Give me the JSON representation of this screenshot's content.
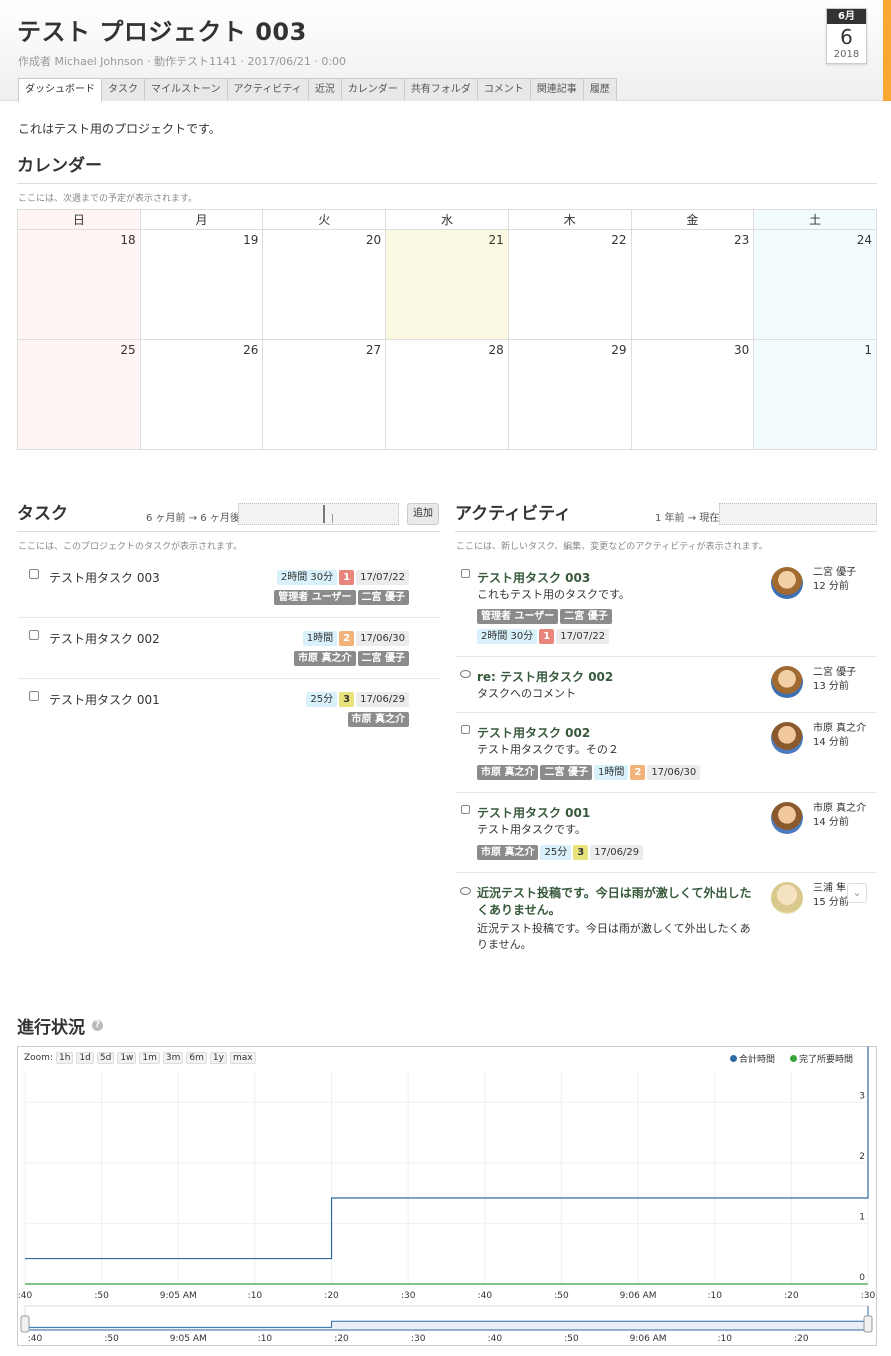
{
  "project": {
    "title": "テスト プロジェクト 003",
    "meta": "作成者 Michael Johnson · 動作テスト1141 · 2017/06/21 · 0:00",
    "description": "これはテスト用のプロジェクトです。"
  },
  "date_badge": {
    "month": "6月",
    "day": "6",
    "year": "2018"
  },
  "tabs": [
    "ダッシュボード",
    "タスク",
    "マイルストーン",
    "アクティビティ",
    "近況",
    "カレンダー",
    "共有フォルダ",
    "コメント",
    "関連記事",
    "履歴"
  ],
  "calendar": {
    "heading": "カレンダー",
    "note": "ここには、次週までの予定が表示されます。",
    "weekdays": [
      "日",
      "月",
      "火",
      "水",
      "木",
      "金",
      "土"
    ],
    "week1": [
      "18",
      "19",
      "20",
      "21",
      "22",
      "23",
      "24"
    ],
    "week2": [
      "25",
      "26",
      "27",
      "28",
      "29",
      "30",
      "1"
    ]
  },
  "tasks": {
    "heading": "タスク",
    "range_label": "6 ヶ月前 → 6 ヶ月後",
    "add_label": "追加",
    "note": "ここには、このプロジェクトのタスクが表示されます。",
    "items": [
      {
        "name": "テスト用タスク 003",
        "time": "2時間 30分",
        "priority": "1",
        "due": "17/07/22",
        "users": [
          "管理者 ユーザー",
          "二宮 優子"
        ]
      },
      {
        "name": "テスト用タスク 002",
        "time": "1時間",
        "priority": "2",
        "due": "17/06/30",
        "users": [
          "市原 真之介",
          "二宮 優子"
        ]
      },
      {
        "name": "テスト用タスク 001",
        "time": "25分",
        "priority": "3",
        "due": "17/06/29",
        "users": [
          "市原 真之介"
        ]
      }
    ]
  },
  "activity": {
    "heading": "アクティビティ",
    "range_label": "1 年前 → 現在",
    "note": "ここには、新しいタスク、編集、変更などのアクティビティが表示されます。",
    "items": [
      {
        "title": "テスト用タスク 003",
        "body": "これもテスト用のタスクです。",
        "users": [
          "管理者 ユーザー",
          "二宮 優子"
        ],
        "time": "2時間 30分",
        "priority": "1",
        "due": "17/07/22",
        "author": "二宮 優子",
        "ago": "12 分前"
      },
      {
        "title": "re: テスト用タスク 002",
        "body": "タスクへのコメント",
        "author": "二宮 優子",
        "ago": "13 分前"
      },
      {
        "title": "テスト用タスク 002",
        "body": "テスト用タスクです。その２",
        "users": [
          "市原 真之介",
          "二宮 優子"
        ],
        "time": "1時間",
        "priority": "2",
        "due": "17/06/30",
        "author": "市原 真之介",
        "ago": "14 分前"
      },
      {
        "title": "テスト用タスク 001",
        "body": "テスト用タスクです。",
        "users": [
          "市原 真之介"
        ],
        "time": "25分",
        "priority": "3",
        "due": "17/06/29",
        "author": "市原 真之介",
        "ago": "14 分前"
      },
      {
        "title_line1": "近況テスト投稿です。今日は雨が激しくて外出した",
        "title_line2": "くありません。",
        "body_line1": "近況テスト投稿です。今日は雨が激しくて外出したくあ",
        "body_line2": "りません。",
        "author": "三浦 隼",
        "ago": "15 分前"
      }
    ]
  },
  "progress": {
    "heading": "進行状況",
    "zoom_label": "Zoom:",
    "zoom_options": [
      "1h",
      "1d",
      "5d",
      "1w",
      "1m",
      "3m",
      "6m",
      "1y",
      "max"
    ],
    "legend": [
      {
        "name": "合計時間",
        "color": "#2f6aa3"
      },
      {
        "name": "完了所要時間",
        "color": "#3aa33a"
      }
    ],
    "y_ticks": [
      "0",
      "1",
      "2",
      "3"
    ],
    "x_ticks": [
      ":40",
      ":50",
      "9:05 AM",
      ":10",
      ":20",
      ":30",
      ":40",
      ":50",
      "9:06 AM",
      ":10",
      ":20",
      ":30"
    ],
    "nav_ticks": [
      ":40",
      ":50",
      "9:05 AM",
      ":10",
      ":20",
      ":30",
      ":40",
      ":50",
      "9:06 AM",
      ":10",
      ":20"
    ]
  },
  "chart_data": {
    "type": "line",
    "x": [
      ":40",
      ":50",
      "9:05 AM",
      ":10",
      ":20",
      ":30",
      ":40",
      ":50",
      "9:06 AM",
      ":10",
      ":20",
      ":30"
    ],
    "series": [
      {
        "name": "合計時間",
        "values": [
          0.42,
          0.42,
          0.42,
          0.42,
          1.42,
          1.42,
          1.42,
          1.42,
          1.42,
          1.42,
          1.42,
          3.92
        ]
      },
      {
        "name": "完了所要時間",
        "values": [
          0,
          0,
          0,
          0,
          0,
          0,
          0,
          0,
          0,
          0,
          0,
          0
        ]
      }
    ],
    "ylim": [
      0,
      3.5
    ],
    "xlabel": "",
    "ylabel": "",
    "legend": "top-right"
  }
}
